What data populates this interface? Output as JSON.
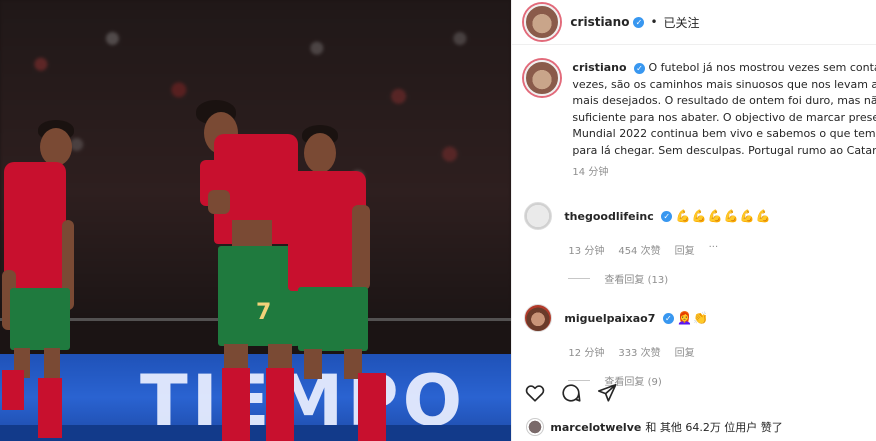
{
  "photo": {
    "banner_text": "TIEMPO",
    "player_number": "7"
  },
  "header": {
    "username": "cristiano",
    "separator": "•",
    "follow_status": "已关注"
  },
  "caption": {
    "username": "cristiano",
    "text": "O futebol já nos mostrou vezes sem conta que, vezes, são os caminhos mais sinuosos que nos levam aos de mais desejados. O resultado de ontem foi duro, mas não o suficiente para nos abater. O objectivo de marcar presença Mundial 2022 continua bem vivo e sabemos o que temos d para lá chegar. Sem desculpas. Portugal rumo ao Catar. 🇵🇹💪",
    "time": "14 分钟"
  },
  "comments": [
    {
      "username": "thegoodlifeinc",
      "text": "💪💪💪💪💪💪",
      "time": "13 分钟",
      "likes": "454 次赞",
      "reply": "回复",
      "more": "···",
      "view_replies": "查看回复 (13)"
    },
    {
      "username": "miguelpaixao7",
      "text": "👩‍🦰👏",
      "time": "12 分钟",
      "likes": "333 次赞",
      "reply": "回复",
      "view_replies": "查看回复 (9)"
    }
  ],
  "likes_line": {
    "username": "marcelotwelve",
    "rest": "和 其他 64.2万 位用户 赞了"
  },
  "colors": {
    "accent": "#3897f0",
    "shirt_red": "#c8102e",
    "shorts_green": "#1f7a3e",
    "banner_blue": "#1f52b8"
  }
}
